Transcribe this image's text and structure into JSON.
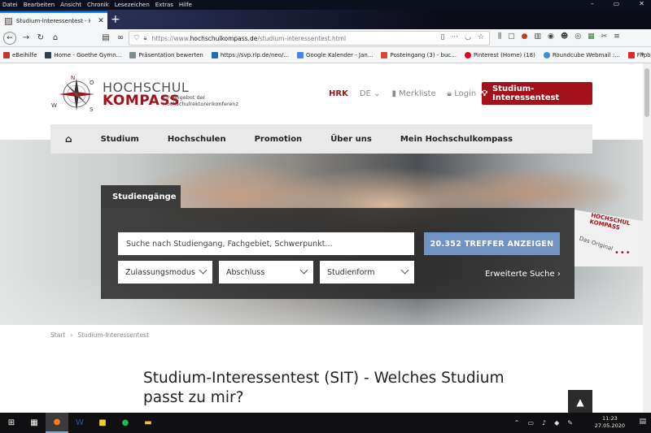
{
  "menubar": [
    "Datei",
    "Bearbeiten",
    "Ansicht",
    "Chronik",
    "Lesezeichen",
    "Extras",
    "Hilfe"
  ],
  "window_controls": [
    "–",
    "▭",
    "✕"
  ],
  "tab": {
    "title": "Studium-Interessentest - Hoch",
    "close": "✕",
    "new": "+"
  },
  "url": {
    "prefix": "https://www.",
    "domain": "hochschulkompass.de",
    "path": "/studium-interessentest.html"
  },
  "bookmarks": [
    {
      "label": "eBeihilfe",
      "color": "#c0392b"
    },
    {
      "label": "Home - Goethe Gymn...",
      "color": "#2c3e50"
    },
    {
      "label": "Präsentation bewerten",
      "color": "#7f8c8d"
    },
    {
      "label": "https://svp.rlp.de/neo/...",
      "color": "#1e6bb8"
    },
    {
      "label": "Google Kalender - Jan...",
      "color": "#4285f4"
    },
    {
      "label": "Posteingang (3) - buc...",
      "color": "#d44638"
    },
    {
      "label": "Pinterest (Home) (18)",
      "color": "#e60023"
    },
    {
      "label": "Roundcube Webmail :...",
      "color": "#3d8fd1"
    },
    {
      "label": "Flipboard - Profil",
      "color": "#e12828"
    }
  ],
  "bookmarks_more": "»",
  "logo": {
    "word1": "HOCHSCHUL",
    "word2": "KOMPASS",
    "tagline": "Ein Angebot der Hochschulrektorenkonferenz",
    "compass_letters": [
      "N",
      "O",
      "S",
      "W"
    ]
  },
  "top_links": {
    "hrk": "HRK",
    "lang": "DE",
    "merkliste": "Merkliste",
    "login": "Login"
  },
  "cta": "Studium-Interessentest",
  "mainnav": [
    "Studium",
    "Hochschulen",
    "Promotion",
    "Über uns",
    "Mein Hochschulkompass"
  ],
  "search": {
    "tab_label": "Studiengänge",
    "placeholder": "Suche nach Studiengang, Fachgebiet, Schwerpunkt...",
    "results_button": "20.352 TREFFER ANZEIGEN",
    "filters": [
      "Zulassungsmodus",
      "Abschluss",
      "Studienform"
    ],
    "advanced": "Erweiterte Suche"
  },
  "badge": {
    "logo_line1": "HOCHSCHUL",
    "logo_line2": "KOMPASS",
    "original": "Das Original",
    "dots": "•••"
  },
  "breadcrumb": [
    "Start",
    "Studium-Interessentest"
  ],
  "page_title": "Studium-Interessentest (SIT) - Welches Studium passt zu mir?",
  "clock": {
    "time": "11:23",
    "date": "27.05.2020"
  },
  "colors": {
    "brand": "#a3121b",
    "results_button": "#6f93c5",
    "nav_bg": "#e9e9e9"
  }
}
